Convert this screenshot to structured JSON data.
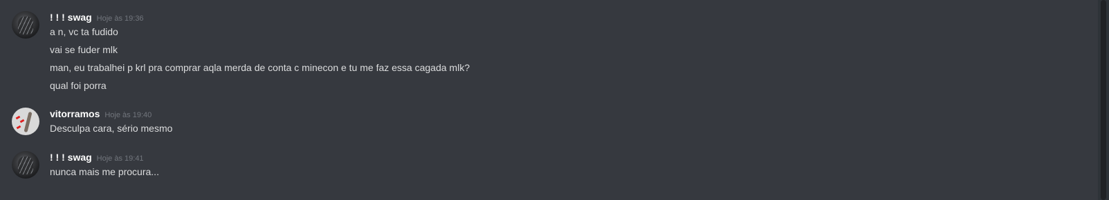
{
  "messages": [
    {
      "author": "! ! ! swag",
      "timestamp": "Hoje às 19:36",
      "avatar": "dark-photo-avatar",
      "lines": [
        "a n, vc ta fudido",
        "vai se fuder mlk",
        "man, eu trabalhei p krl pra comprar aqla merda de conta c minecon e tu me faz essa cagada mlk?",
        "qual foi porra"
      ]
    },
    {
      "author": "vitorramos",
      "timestamp": "Hoje às 19:40",
      "avatar": "light-sketch-avatar",
      "lines": [
        "Desculpa cara, sério mesmo"
      ]
    },
    {
      "author": "! ! ! swag",
      "timestamp": "Hoje às 19:41",
      "avatar": "dark-photo-avatar",
      "lines": [
        "nunca mais me procura..."
      ]
    }
  ],
  "colors": {
    "background": "#36393f",
    "username": "#ffffff",
    "message_text": "#dcddde",
    "timestamp": "#72767d",
    "scrollbar_track": "#2e3338",
    "scrollbar_thumb": "#202225"
  }
}
